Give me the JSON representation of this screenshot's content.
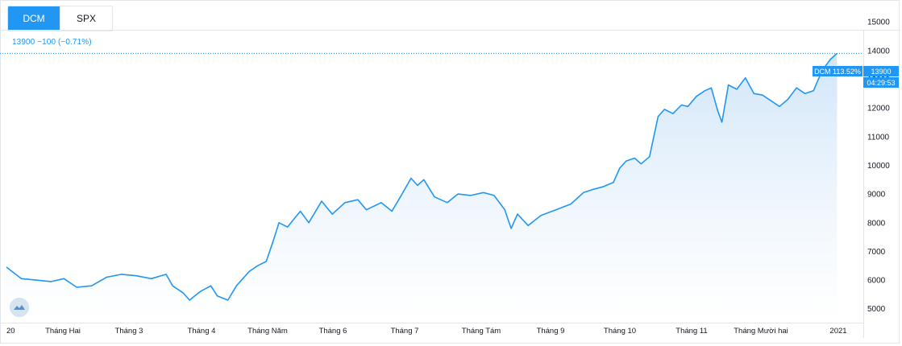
{
  "tabs": [
    {
      "label": "DCM",
      "active": true
    },
    {
      "label": "SPX",
      "active": false
    }
  ],
  "quote_text": "13900 −100 (−0.71%)",
  "price_tag": {
    "label": "DCM 113.52%",
    "value": "13900",
    "countdown": "04:29:53"
  },
  "colors": {
    "line": "#2196f3",
    "accent": "#2196f3",
    "fill_top": "#cfe4f8",
    "fill_bottom": "#ffffff"
  },
  "icons": {
    "logo": "tradingview-cloud-icon"
  },
  "chart_data": {
    "type": "area",
    "series": [
      {
        "name": "DCM",
        "points": [
          [
            "2020-01-01",
            6450
          ],
          [
            "2020-01-08",
            6050
          ],
          [
            "2020-01-15",
            6000
          ],
          [
            "2020-01-22",
            5950
          ],
          [
            "2020-01-28",
            6050
          ],
          [
            "2020-02-03",
            5750
          ],
          [
            "2020-02-10",
            5800
          ],
          [
            "2020-02-17",
            6100
          ],
          [
            "2020-02-24",
            6200
          ],
          [
            "2020-03-02",
            6150
          ],
          [
            "2020-03-09",
            6050
          ],
          [
            "2020-03-16",
            6200
          ],
          [
            "2020-03-19",
            5800
          ],
          [
            "2020-03-24",
            5550
          ],
          [
            "2020-03-27",
            5300
          ],
          [
            "2020-04-01",
            5600
          ],
          [
            "2020-04-06",
            5800
          ],
          [
            "2020-04-09",
            5450
          ],
          [
            "2020-04-14",
            5300
          ],
          [
            "2020-04-18",
            5800
          ],
          [
            "2020-04-24",
            6300
          ],
          [
            "2020-04-28",
            6500
          ],
          [
            "2020-05-02",
            6650
          ],
          [
            "2020-05-05",
            7300
          ],
          [
            "2020-05-08",
            8000
          ],
          [
            "2020-05-12",
            7850
          ],
          [
            "2020-05-18",
            8400
          ],
          [
            "2020-05-22",
            8000
          ],
          [
            "2020-05-28",
            8750
          ],
          [
            "2020-06-02",
            8300
          ],
          [
            "2020-06-08",
            8700
          ],
          [
            "2020-06-14",
            8800
          ],
          [
            "2020-06-18",
            8450
          ],
          [
            "2020-06-25",
            8700
          ],
          [
            "2020-06-30",
            8400
          ],
          [
            "2020-07-04",
            8900
          ],
          [
            "2020-07-09",
            9550
          ],
          [
            "2020-07-12",
            9300
          ],
          [
            "2020-07-15",
            9500
          ],
          [
            "2020-07-20",
            8900
          ],
          [
            "2020-07-26",
            8700
          ],
          [
            "2020-07-31",
            9000
          ],
          [
            "2020-08-06",
            8950
          ],
          [
            "2020-08-12",
            9050
          ],
          [
            "2020-08-17",
            8950
          ],
          [
            "2020-08-22",
            8450
          ],
          [
            "2020-08-25",
            7800
          ],
          [
            "2020-08-28",
            8300
          ],
          [
            "2020-09-02",
            7900
          ],
          [
            "2020-09-08",
            8250
          ],
          [
            "2020-09-15",
            8450
          ],
          [
            "2020-09-22",
            8650
          ],
          [
            "2020-09-28",
            9050
          ],
          [
            "2020-10-02",
            9150
          ],
          [
            "2020-10-07",
            9250
          ],
          [
            "2020-10-12",
            9400
          ],
          [
            "2020-10-15",
            9900
          ],
          [
            "2020-10-18",
            10150
          ],
          [
            "2020-10-22",
            10250
          ],
          [
            "2020-10-25",
            10050
          ],
          [
            "2020-10-29",
            10300
          ],
          [
            "2020-11-02",
            11700
          ],
          [
            "2020-11-05",
            11950
          ],
          [
            "2020-11-09",
            11800
          ],
          [
            "2020-11-13",
            12100
          ],
          [
            "2020-11-16",
            12050
          ],
          [
            "2020-11-20",
            12400
          ],
          [
            "2020-11-24",
            12600
          ],
          [
            "2020-11-27",
            12700
          ],
          [
            "2020-11-30",
            11900
          ],
          [
            "2020-12-02",
            11500
          ],
          [
            "2020-12-05",
            12800
          ],
          [
            "2020-12-09",
            12650
          ],
          [
            "2020-12-13",
            13050
          ],
          [
            "2020-12-17",
            12500
          ],
          [
            "2020-12-21",
            12450
          ],
          [
            "2020-12-25",
            12250
          ],
          [
            "2020-12-29",
            12050
          ],
          [
            "2021-01-02",
            12300
          ],
          [
            "2021-01-06",
            12700
          ],
          [
            "2021-01-10",
            12500
          ],
          [
            "2021-01-14",
            12600
          ],
          [
            "2021-01-18",
            13300
          ],
          [
            "2021-01-22",
            13700
          ],
          [
            "2021-01-25",
            13900
          ]
        ]
      }
    ],
    "x_ticks": [
      "20",
      "Tháng Hai",
      "Tháng 3",
      "Tháng 4",
      "Tháng Năm",
      "Tháng 6",
      "Tháng 7",
      "Tháng Tám",
      "Tháng 9",
      "Tháng 10",
      "Tháng 11",
      "Tháng Mười hai",
      "2021"
    ],
    "y_ticks": [
      15000,
      14000,
      13000,
      12000,
      11000,
      10000,
      9000,
      8000,
      7000,
      6000,
      5000
    ],
    "ylim": [
      4600,
      15200
    ],
    "xlim": [
      "2020-01-01",
      "2021-02-06"
    ],
    "grid": false,
    "last_value_line": 13900
  }
}
